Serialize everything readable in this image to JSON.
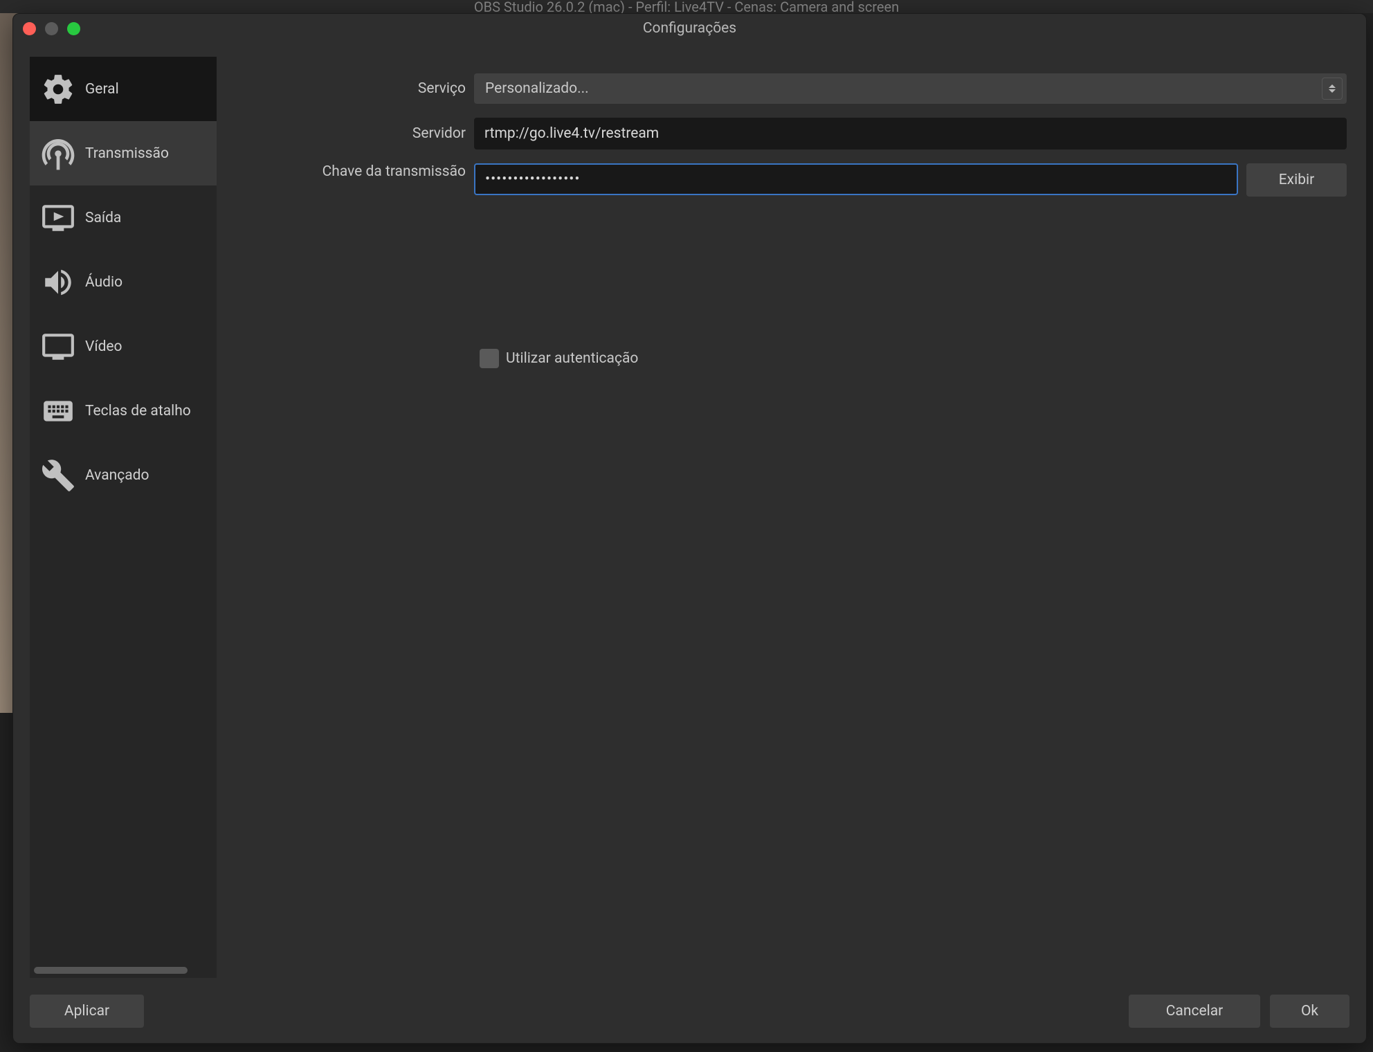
{
  "app_title_partial": "OBS Studio 26.0.2 (mac) - Perfil: Live4TV - Cenas: Camera and screen",
  "window_title": "Configurações",
  "sidebar": {
    "items": [
      {
        "label": "Geral",
        "icon": "gear-icon"
      },
      {
        "label": "Transmissão",
        "icon": "broadcast-icon"
      },
      {
        "label": "Saída",
        "icon": "output-icon"
      },
      {
        "label": "Áudio",
        "icon": "audio-icon"
      },
      {
        "label": "Vídeo",
        "icon": "video-icon"
      },
      {
        "label": "Teclas de atalho",
        "icon": "keyboard-icon"
      },
      {
        "label": "Avançado",
        "icon": "tools-icon"
      }
    ],
    "active_index": 1
  },
  "form": {
    "service_label": "Serviço",
    "service_value": "Personalizado...",
    "server_label": "Servidor",
    "server_value": "rtmp://go.live4.tv/restream",
    "stream_key_label": "Chave da transmissão",
    "stream_key_value": "•••••••••••••••••",
    "show_button": "Exibir",
    "use_auth_label": "Utilizar autenticação",
    "use_auth_checked": false
  },
  "footer": {
    "apply": "Aplicar",
    "cancel": "Cancelar",
    "ok": "Ok"
  }
}
